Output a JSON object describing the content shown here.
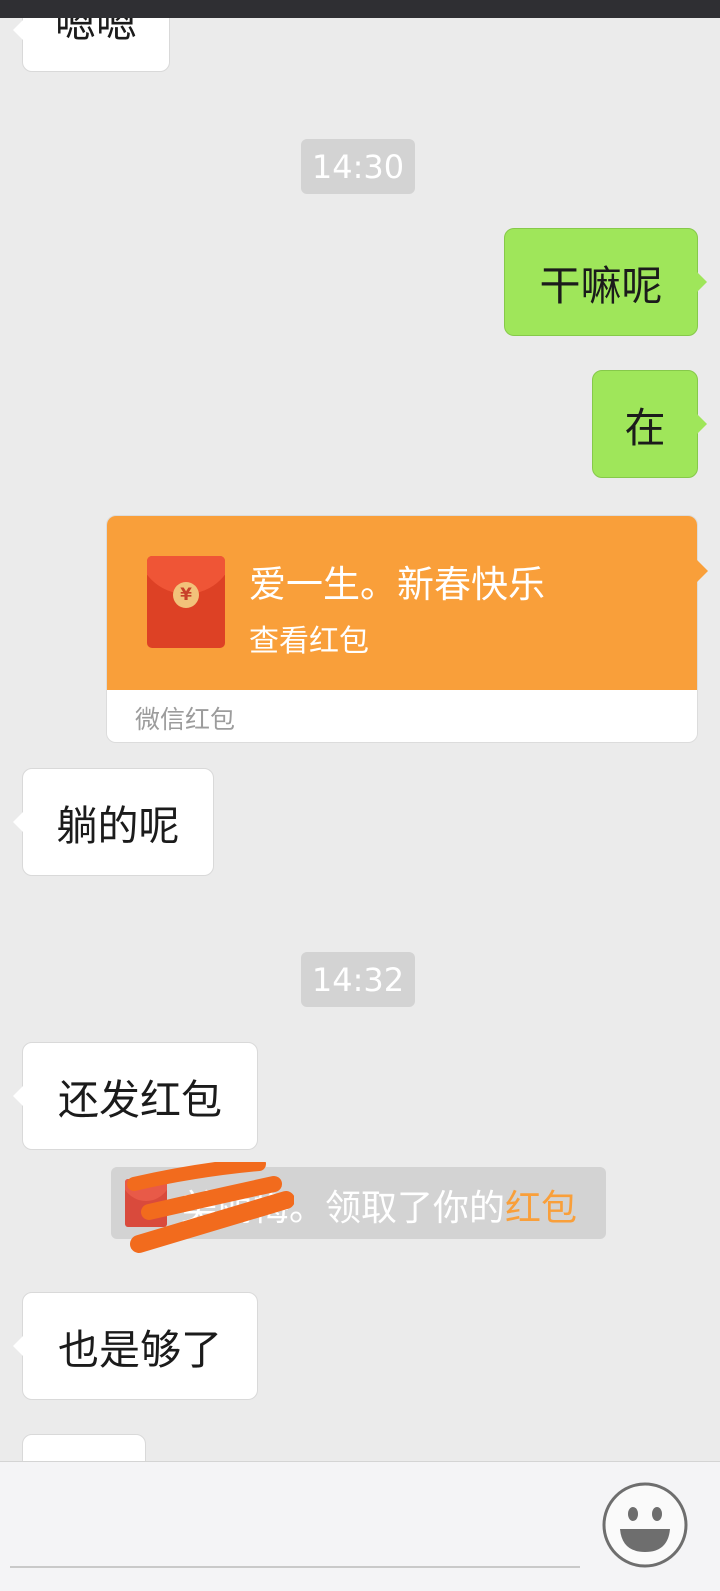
{
  "messages": {
    "m0": "嗯嗯",
    "t1": "14:30",
    "m1": "干嘛呢",
    "m2": "在",
    "m4": "躺的呢",
    "t2": "14:32",
    "m5": "还发红包",
    "m6": "也是够了"
  },
  "red_packet": {
    "title": "爱一生。新春快乐",
    "action": "查看红包",
    "footer": "微信红包",
    "currency_symbol": "¥"
  },
  "notice": {
    "text": "美丽梅。领取了你的",
    "highlight": "红包"
  },
  "input_bar": {
    "emoji_icon": "smiley-face-icon"
  },
  "colors": {
    "outgoing_bubble": "#9fe65a",
    "incoming_bubble": "#ffffff",
    "red_packet": "#f99f3a",
    "background": "#ebebeb",
    "scribble": "#f26b1d"
  }
}
